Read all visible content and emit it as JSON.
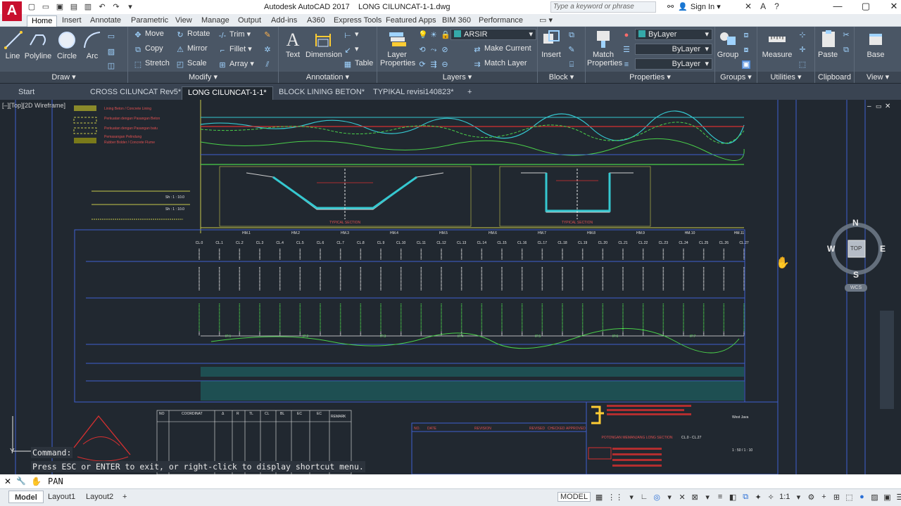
{
  "app": {
    "title": "Autodesk AutoCAD 2017",
    "file": "LONG CILUNCAT-1-1.dwg",
    "logo": "A"
  },
  "search": {
    "placeholder": "Type a keyword or phrase"
  },
  "account": {
    "signin": "Sign In"
  },
  "ribbon_tabs": [
    "Home",
    "Insert",
    "Annotate",
    "Parametric",
    "View",
    "Manage",
    "Output",
    "Add-ins",
    "A360",
    "Express Tools",
    "Featured Apps",
    "BIM 360",
    "Performance"
  ],
  "draw": {
    "line": "Line",
    "polyline": "Polyline",
    "circle": "Circle",
    "arc": "Arc",
    "label": "Draw ▾"
  },
  "modify": {
    "move": "Move",
    "rotate": "Rotate",
    "trim": "Trim ▾",
    "copy": "Copy",
    "mirror": "Mirror",
    "fillet": "Fillet ▾",
    "stretch": "Stretch",
    "scale": "Scale",
    "array": "Array ▾",
    "label": "Modify ▾"
  },
  "annotation": {
    "text": "Text",
    "dimension": "Dimension",
    "table": "Table",
    "label": "Annotation ▾"
  },
  "layers": {
    "properties": "Layer Properties",
    "current_layer": "ARSIR",
    "make_current": "Make Current",
    "match_layer": "Match Layer",
    "label": "Layers ▾"
  },
  "block": {
    "insert": "Insert",
    "label": "Block ▾"
  },
  "properties": {
    "match": "Match Properties",
    "color": "ByLayer",
    "linetype": "ByLayer",
    "lineweight": "ByLayer",
    "label": "Properties ▾"
  },
  "groups": {
    "group": "Group",
    "label": "Groups ▾"
  },
  "utilities": {
    "measure": "Measure",
    "label": "Utilities ▾"
  },
  "clipboard": {
    "paste": "Paste",
    "label": "Clipboard"
  },
  "view": {
    "base": "Base",
    "label": "View ▾"
  },
  "doc_tabs": [
    "Start",
    "CROSS CILUNCAT Rev5*",
    "LONG CILUNCAT-1-1*",
    "BLOCK LINING BETON*",
    "TYPIKAL revisi140823*"
  ],
  "viewport": {
    "label": "[–][Top][2D Wireframe]"
  },
  "viewcube": {
    "n": "N",
    "s": "S",
    "e": "E",
    "w": "W",
    "face": "TOP",
    "wcs": "WCS"
  },
  "command": {
    "prompt": "Command:",
    "message": "Press ESC or ENTER to exit, or right-click to display shortcut menu.",
    "current": "PAN"
  },
  "layouts": [
    "Model",
    "Layout1",
    "Layout2"
  ],
  "status": {
    "model": "MODEL",
    "scale": "1:1"
  },
  "drawing": {
    "legend": [
      "Lining Beton / Concrete Lining",
      "Perkuatan dengan Pasangan Beton",
      "Perkuatan dengan Pasangan batu",
      "Pemasangan Pelindung",
      "Rubber Bolder / Concrete Flume"
    ],
    "scale_note": "Sh : 1 : 10.0",
    "stations_hm": [
      "HM.1",
      "HM.2",
      "HM.3",
      "HM.4",
      "HM.5",
      "HM.6",
      "HM.7",
      "HM.8",
      "HM.9",
      "HM.10",
      "HM.11"
    ],
    "stations_cl": [
      "CL.0",
      "CL.1",
      "CL.2",
      "CL.3",
      "CL.4",
      "CL.5",
      "CL.6",
      "CL.7",
      "CL.8",
      "CL.9",
      "CL.10",
      "CL.11",
      "CL.12",
      "CL.13",
      "CL.14",
      "CL.15",
      "CL.16",
      "CL.17",
      "CL.18",
      "CL.19",
      "CL.20",
      "CL.21",
      "CL.22",
      "CL.23",
      "CL.24",
      "CL.25",
      "CL.26",
      "CL.27"
    ],
    "section_title": "TYPICAL SECTION",
    "ip_labels": [
      "IP.1",
      "IP.2",
      "IP.3",
      "IP.4",
      "IP.5",
      "IP.6",
      "IP.7"
    ],
    "table_headers": [
      "NO",
      "COORDINAT",
      "Δ",
      "R",
      "TL",
      "CL",
      "BL",
      "EC",
      "EC"
    ],
    "remark": "REMARK",
    "revision_headers": [
      "NO.",
      "DATE",
      "REVISION",
      "REVISED",
      "CHECKED",
      "APPROVED"
    ],
    "drawing_title": "POTONGAN MEMANJANG LONG SECTION",
    "drawing_range": "CL.0 - CL.27",
    "province": "West Java",
    "scale_box": "1 : 50 / 1 : 10"
  }
}
